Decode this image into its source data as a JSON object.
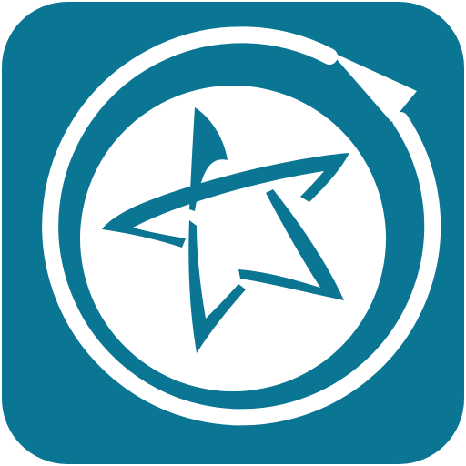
{
  "app_icon": {
    "icon_name": "compass-star-app-icon",
    "colors": {
      "background": "#0b7693",
      "foreground": "#ffffff",
      "page": "#ffffff"
    }
  }
}
